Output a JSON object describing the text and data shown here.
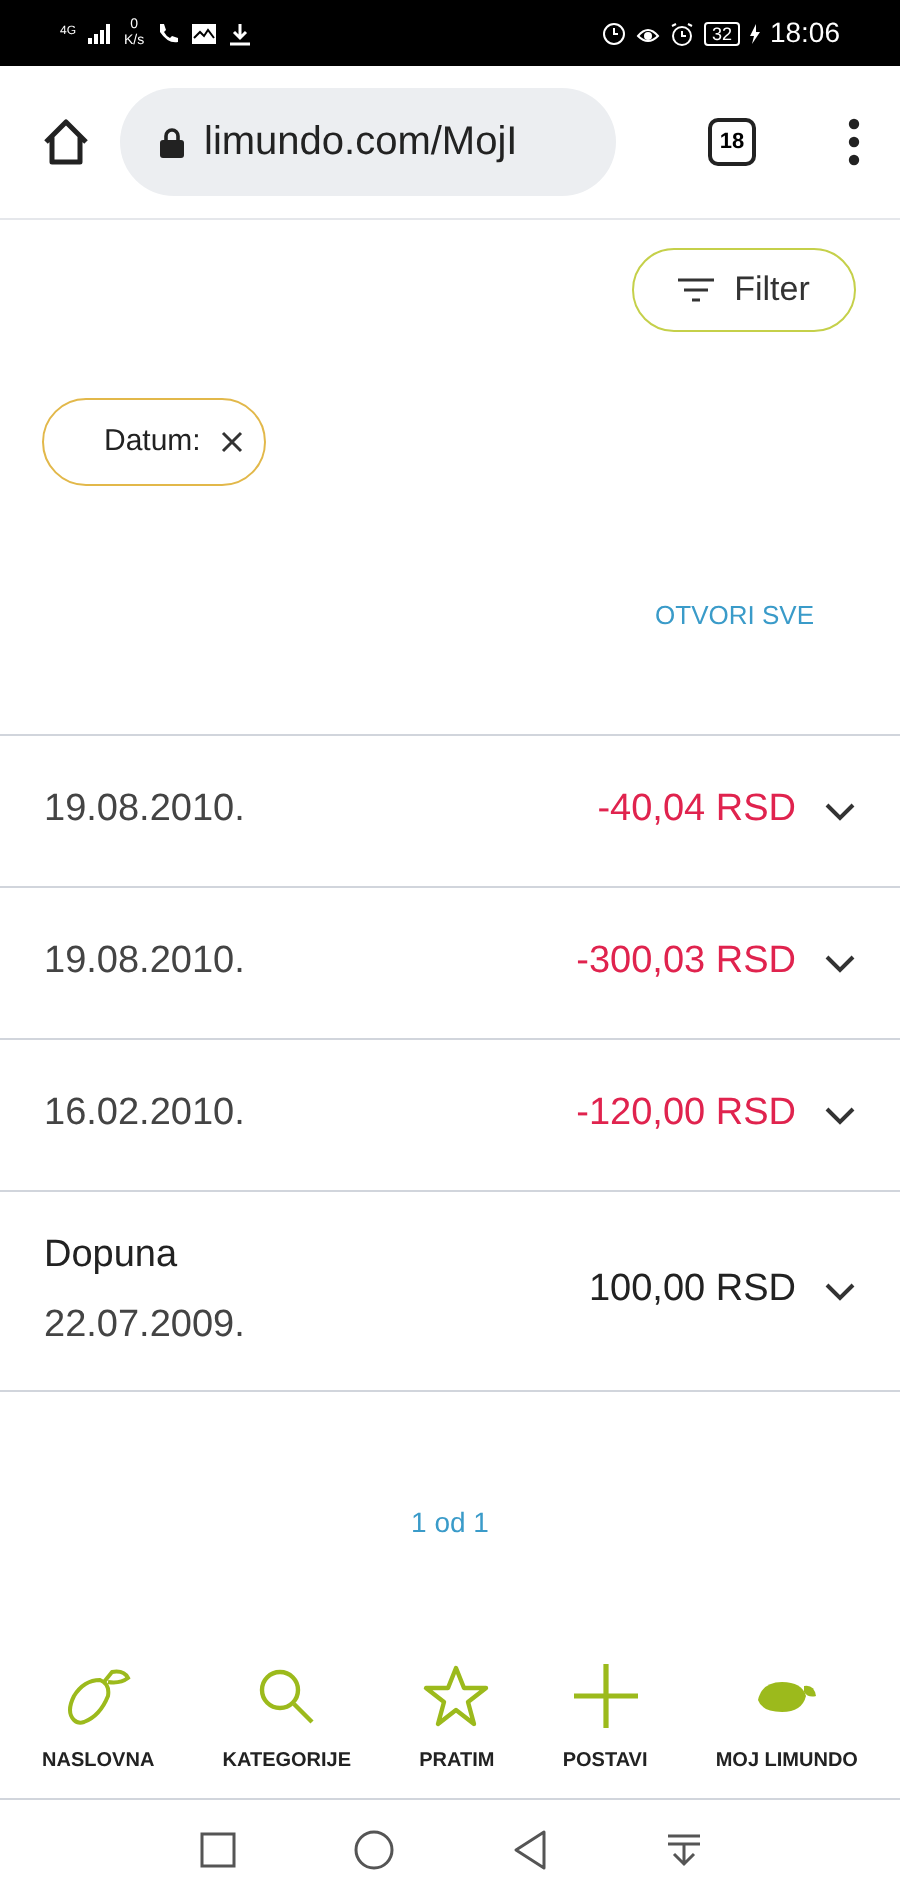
{
  "status_bar": {
    "network": "4G",
    "speed_value": "0",
    "speed_unit": "K/s",
    "battery": "32",
    "time": "18:06"
  },
  "browser": {
    "url": "limundo.com/MojI",
    "tab_count": "18"
  },
  "filter_button": {
    "label": "Filter"
  },
  "chips": [
    {
      "label": "Datum:"
    }
  ],
  "open_all": "OTVORI SVE",
  "transactions": [
    {
      "date": "19.08.2010.",
      "amount": "-40,04 RSD",
      "kind": "debit"
    },
    {
      "date": "19.08.2010.",
      "amount": "-300,03 RSD",
      "kind": "debit"
    },
    {
      "date": "16.02.2010.",
      "amount": "-120,00 RSD",
      "kind": "debit"
    },
    {
      "title": "Dopuna",
      "date": "22.07.2009.",
      "amount": "100,00 RSD",
      "kind": "credit"
    }
  ],
  "pagination": "1 od 1",
  "bottom_nav": [
    {
      "label": "NASLOVNA"
    },
    {
      "label": "KATEGORIJE"
    },
    {
      "label": "PRATIM"
    },
    {
      "label": "POSTAVI"
    },
    {
      "label": "MOJ LIMUNDO"
    }
  ]
}
